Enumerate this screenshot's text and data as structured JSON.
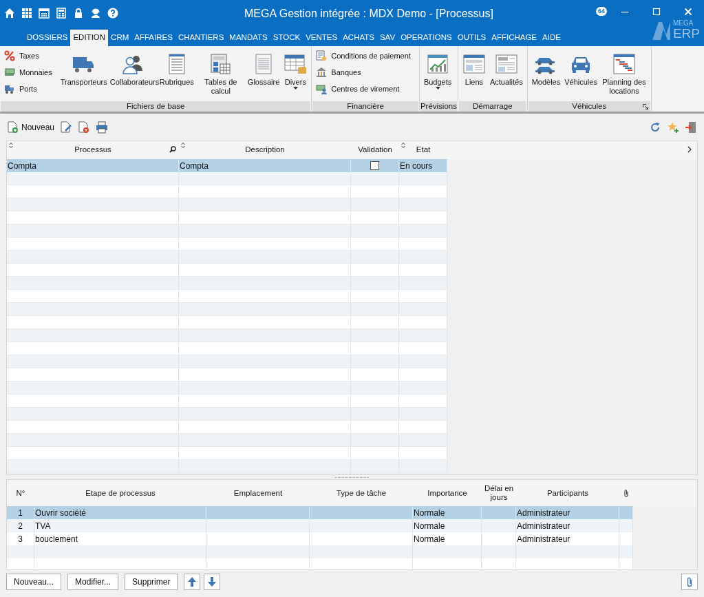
{
  "window": {
    "title": "MEGA Gestion intégrée : MDX Demo - [Processus]",
    "badge": "64"
  },
  "menu_tabs": [
    {
      "label": "DOSSIERS",
      "selected": false
    },
    {
      "label": "EDITION",
      "selected": true
    },
    {
      "label": "CRM",
      "selected": false
    },
    {
      "label": "AFFAIRES",
      "selected": false
    },
    {
      "label": "CHANTIERS",
      "selected": false
    },
    {
      "label": "MANDATS",
      "selected": false
    },
    {
      "label": "STOCK",
      "selected": false
    },
    {
      "label": "VENTES",
      "selected": false
    },
    {
      "label": "ACHATS",
      "selected": false
    },
    {
      "label": "SAV",
      "selected": false
    },
    {
      "label": "OPERATIONS",
      "selected": false
    },
    {
      "label": "OUTILS",
      "selected": false
    },
    {
      "label": "AFFICHAGE",
      "selected": false
    },
    {
      "label": "AIDE",
      "selected": false
    }
  ],
  "logo": {
    "top": "MEGA",
    "bottom": "ERP"
  },
  "ribbon_groups": [
    {
      "label": "Fichiers de base",
      "items": [
        {
          "kind": "small",
          "label": "Taxes"
        },
        {
          "kind": "small",
          "label": "Monnaies"
        },
        {
          "kind": "small",
          "label": "Ports"
        },
        {
          "kind": "large",
          "label": "Transporteurs",
          "dropdown": false
        },
        {
          "kind": "large",
          "label": "Collaborateurs",
          "dropdown": false
        },
        {
          "kind": "large",
          "label": "Rubriques",
          "dropdown": false
        },
        {
          "kind": "large",
          "label": "Tables de calcul",
          "dropdown": false
        },
        {
          "kind": "large",
          "label": "Glossaire",
          "dropdown": false
        },
        {
          "kind": "large",
          "label": "Divers",
          "dropdown": true
        }
      ]
    },
    {
      "label": "Financière",
      "items": [
        {
          "kind": "small",
          "label": "Conditions de paiement"
        },
        {
          "kind": "small",
          "label": "Banques"
        },
        {
          "kind": "small",
          "label": "Centres de virement"
        }
      ]
    },
    {
      "label": "Prévisions",
      "items": [
        {
          "kind": "large",
          "label": "Budgets",
          "dropdown": true
        }
      ]
    },
    {
      "label": "Démarrage",
      "items": [
        {
          "kind": "large",
          "label": "Liens",
          "dropdown": false
        },
        {
          "kind": "large",
          "label": "Actualités",
          "dropdown": false
        }
      ]
    },
    {
      "label": "Véhicules",
      "launcher": true,
      "items": [
        {
          "kind": "large",
          "label": "Modèles",
          "dropdown": false
        },
        {
          "kind": "large",
          "label": "Véhicules",
          "dropdown": false
        },
        {
          "kind": "large",
          "label": "Planning des locations",
          "dropdown": false
        }
      ]
    }
  ],
  "toolbar": {
    "new_label": "Nouveau"
  },
  "process_table": {
    "columns": [
      {
        "label": "Processus",
        "sortable": true,
        "search": true
      },
      {
        "label": "Description",
        "sortable": true,
        "search": false
      },
      {
        "label": "Validation",
        "sortable": false,
        "search": false
      },
      {
        "label": "Etat",
        "sortable": true,
        "search": false
      }
    ],
    "rows": [
      {
        "processus": "Compta",
        "description": "Compta",
        "validation": false,
        "etat": "En cours",
        "selected": true
      }
    ]
  },
  "steps_table": {
    "columns": [
      "N°",
      "Etape de processus",
      "Emplacement",
      "Type de tâche",
      "Importance",
      "Délai en jours",
      "Participants"
    ],
    "rows": [
      {
        "number": "1",
        "step": "Ouvrir société",
        "importance": "Normale",
        "participants": "Administrateur",
        "selected": true
      },
      {
        "number": "2",
        "step": "TVA",
        "importance": "Normale",
        "participants": "Administrateur",
        "selected": false
      },
      {
        "number": "3",
        "step": "bouclement",
        "importance": "Normale",
        "participants": "Administrateur",
        "selected": false
      }
    ]
  },
  "bottom_buttons": [
    "Nouveau...",
    "Modifier...",
    "Supprimer"
  ]
}
